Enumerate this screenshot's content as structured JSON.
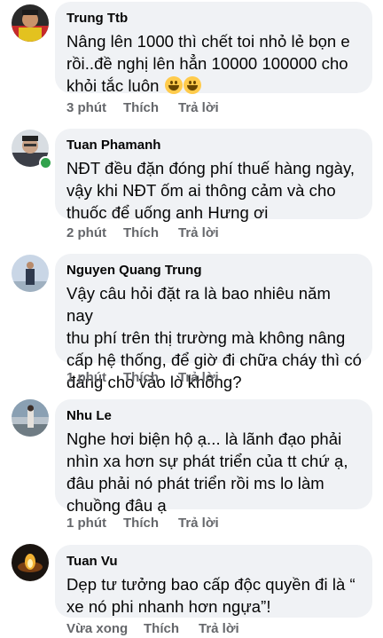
{
  "comments": [
    {
      "author": "Trung Ttb",
      "lines": [
        "Nâng lên 1000 thì chết toi nhỏ lẻ bọn e",
        "rồi..đề nghị lên hẳn 10000 100000 cho",
        "khỏi tắc luôn"
      ],
      "emoji": [
        "grinning-face-emoji",
        "grinning-face-emoji"
      ],
      "time": "3 phút",
      "like": "Thích",
      "reply": "Trả lời"
    },
    {
      "author": "Tuan Phamanh",
      "lines": [
        "NĐT đều đặn đóng phí thuế hàng ngày,",
        "vậy khi NĐT ốm ai thông cảm và cho",
        "thuốc để uống anh Hưng ơi"
      ],
      "time": "2 phút",
      "like": "Thích",
      "reply": "Trả lời",
      "online": true
    },
    {
      "author": "Nguyen Quang Trung",
      "lines": [
        "Vậy câu hỏi đặt ra là bao nhiêu năm nay",
        "thu phí trên thị trường mà không nâng",
        "cấp hệ thống, để giờ đi chữa cháy thì có",
        "đáng cho vào lò không?"
      ],
      "time": "1 phút",
      "like": "Thích",
      "reply": "Trả lời"
    },
    {
      "author": "Nhu Le",
      "lines": [
        "Nghe hơi biện hộ ạ... là lãnh đạo phải",
        "nhìn xa hơn sự phát triển của tt chứ ạ,",
        "đâu phải nó phát triển rồi ms lo làm",
        "chuồng đâu ạ"
      ],
      "time": "1 phút",
      "like": "Thích",
      "reply": "Trả lời"
    },
    {
      "author": "Tuan Vu",
      "lines": [
        "Dẹp tư tưởng bao cấp độc quyền đi là “",
        "xe nó phi nhanh hơn ngựa”!"
      ],
      "time": "Vừa xong",
      "like": "Thích",
      "reply": "Trả lời"
    }
  ]
}
